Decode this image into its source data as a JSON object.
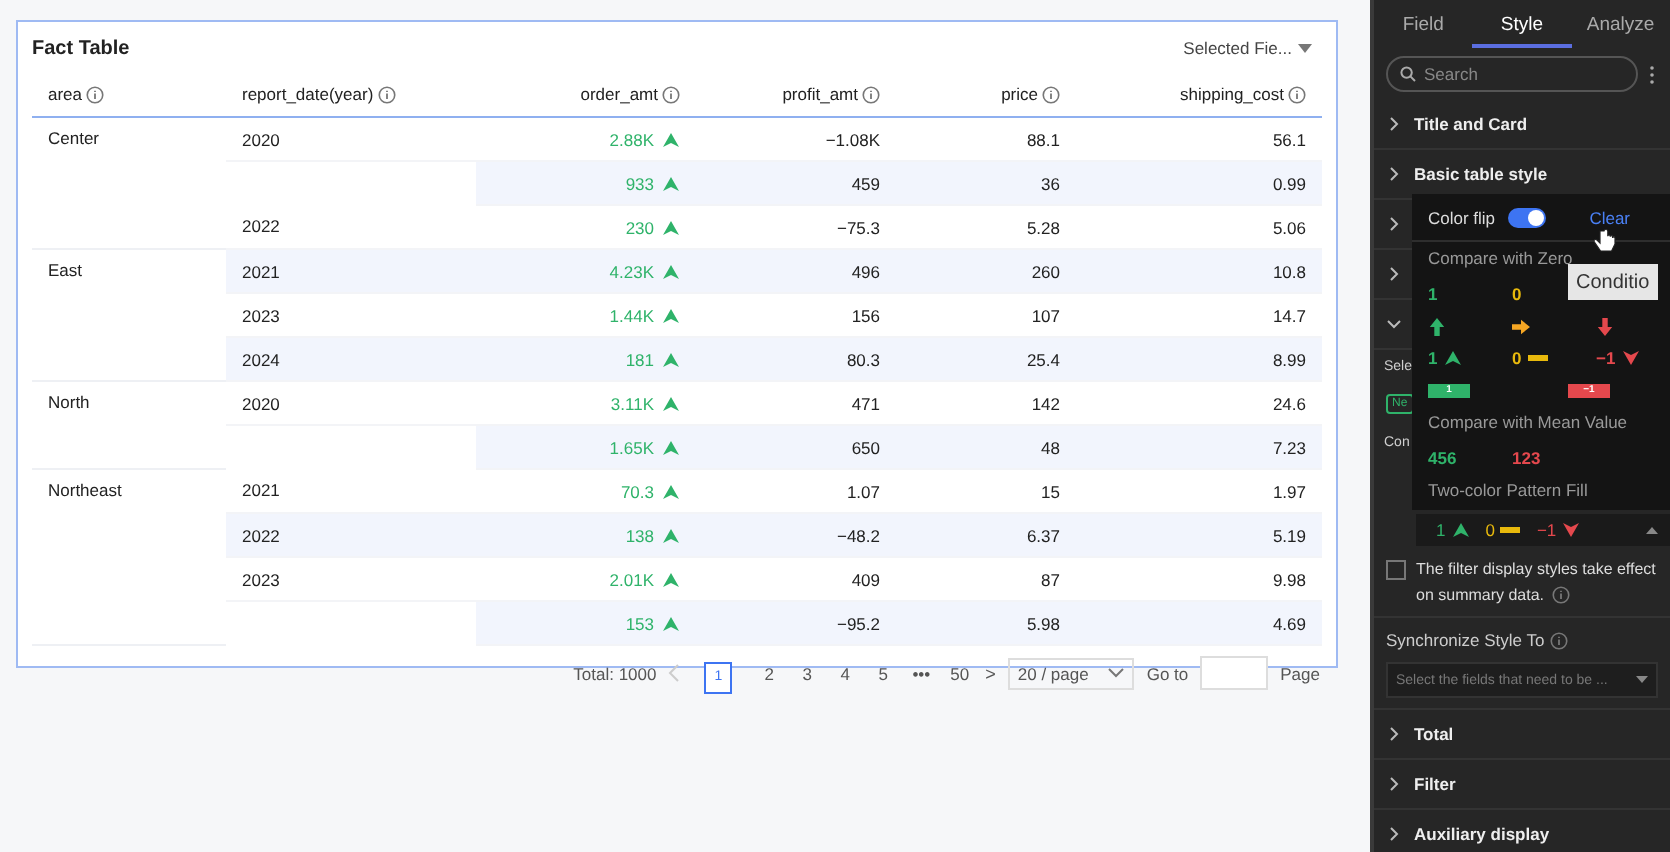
{
  "card": {
    "title": "Fact Table",
    "field_picker": "Selected Fie...",
    "columns": [
      {
        "label": "area"
      },
      {
        "label": "report_date(year)"
      },
      {
        "label": "order_amt"
      },
      {
        "label": "profit_amt"
      },
      {
        "label": "price"
      },
      {
        "label": "shipping_cost"
      }
    ],
    "rows": [
      {
        "area": "Center",
        "date": "2020",
        "order_amt": "2.88K",
        "profit_amt": "−1.08K",
        "price": "88.1",
        "shipping_cost": "56.1"
      },
      {
        "order_amt": "933",
        "profit_amt": "459",
        "price": "36",
        "shipping_cost": "0.99"
      },
      {
        "date": "2022",
        "order_amt": "230",
        "profit_amt": "−75.3",
        "price": "5.28",
        "shipping_cost": "5.06"
      },
      {
        "area": "East",
        "date": "2021",
        "order_amt": "4.23K",
        "profit_amt": "496",
        "price": "260",
        "shipping_cost": "10.8"
      },
      {
        "date": "2023",
        "order_amt": "1.44K",
        "profit_amt": "156",
        "price": "107",
        "shipping_cost": "14.7"
      },
      {
        "date": "2024",
        "order_amt": "181",
        "profit_amt": "80.3",
        "price": "25.4",
        "shipping_cost": "8.99"
      },
      {
        "area": "North",
        "date": "2020",
        "order_amt": "3.11K",
        "profit_amt": "471",
        "price": "142",
        "shipping_cost": "24.6"
      },
      {
        "order_amt": "1.65K",
        "profit_amt": "650",
        "price": "48",
        "shipping_cost": "7.23"
      },
      {
        "area": "Northeast",
        "date": "2021",
        "order_amt": "70.3",
        "profit_amt": "1.07",
        "price": "15",
        "shipping_cost": "1.97"
      },
      {
        "date": "2022",
        "order_amt": "138",
        "profit_amt": "−48.2",
        "price": "6.37",
        "shipping_cost": "5.19"
      },
      {
        "date": "2023",
        "order_amt": "2.01K",
        "profit_amt": "409",
        "price": "87",
        "shipping_cost": "9.98"
      },
      {
        "order_amt": "153",
        "profit_amt": "−95.2",
        "price": "5.98",
        "shipping_cost": "4.69"
      }
    ],
    "pagination": {
      "total": "Total: 1000",
      "pages": [
        {
          "label": "1",
          "selected": true
        },
        {
          "label": "2",
          "selected": false
        },
        {
          "label": "3",
          "selected": false
        },
        {
          "label": "4",
          "selected": false
        },
        {
          "label": "5",
          "selected": false
        },
        {
          "label": "•••",
          "selected": false
        },
        {
          "label": "50",
          "selected": false
        }
      ],
      "prev_disabled": true,
      "next": ">",
      "page_size": "20 / page",
      "goto": "Go to",
      "page": "Page"
    }
  },
  "panel": {
    "tabs": [
      {
        "label": "Field",
        "selected": false
      },
      {
        "label": "Style",
        "selected": true
      },
      {
        "label": "Analyze",
        "selected": false
      }
    ],
    "search": {
      "placeholder": "Search"
    },
    "sections": [
      {
        "title": "Title and Card",
        "expanded": false
      },
      {
        "title": "Basic table style",
        "expanded": false
      },
      {
        "expanded": false
      },
      {
        "expanded": false
      },
      {
        "expanded": true
      }
    ],
    "partial_label_1": "Sele",
    "tag": "Ne",
    "partial_label_2": "Con",
    "preview": [
      {
        "text": "1",
        "kind": "up",
        "color": "#2fb36a"
      },
      {
        "text": "0",
        "kind": "flat",
        "color": "#e8b90c"
      },
      {
        "text": "−1",
        "kind": "down",
        "color": "#e5484d"
      }
    ],
    "checkbox": {
      "label_lines": [
        "The filter display styles take effect",
        "on summary data."
      ],
      "checked": false
    },
    "sync_label": "Synchronize Style To",
    "sync_placeholder": "Select the fields that need to be ...",
    "more_sections": [
      {
        "title": "Total",
        "expanded": false
      },
      {
        "title": "Filter",
        "expanded": false
      },
      {
        "title": "Auxiliary display",
        "expanded": false
      }
    ]
  },
  "popover": {
    "color_flip": {
      "label": "Color flip",
      "on": true
    },
    "clear": "Clear",
    "groups": [
      {
        "title": "Compare with Zero",
        "rows": [
          {
            "kind": "text",
            "items": [
              {
                "text": "1",
                "color": "#2fb36a"
              },
              {
                "text": "0",
                "color": "#e8b90c"
              }
            ]
          },
          {
            "kind": "arrow",
            "items": [
              {
                "kind": "up",
                "color": "#2fb36a"
              },
              {
                "kind": "right",
                "color": "#f5a623"
              },
              {
                "kind": "down",
                "color": "#e5484d"
              }
            ]
          },
          {
            "kind": "indicator",
            "items": [
              {
                "text": "1",
                "kind": "up",
                "color": "#2fb36a"
              },
              {
                "text": "0",
                "kind": "flat",
                "color": "#e8b90c"
              },
              {
                "text": "−1",
                "kind": "down",
                "color": "#e5484d"
              }
            ]
          },
          {
            "kind": "bar",
            "items": [
              {
                "text": "1",
                "color": "#2fb36a"
              },
              {
                "text": "−1",
                "color": "#e5484d"
              }
            ]
          }
        ]
      },
      {
        "title": "Compare with Mean Value",
        "rows": [
          {
            "kind": "text",
            "items": [
              {
                "text": "456",
                "color": "#2fb36a"
              },
              {
                "text": "123",
                "color": "#e5484d"
              }
            ]
          }
        ]
      },
      {
        "title": "Two-color Pattern Fill"
      }
    ]
  },
  "tooltip": "Conditio"
}
